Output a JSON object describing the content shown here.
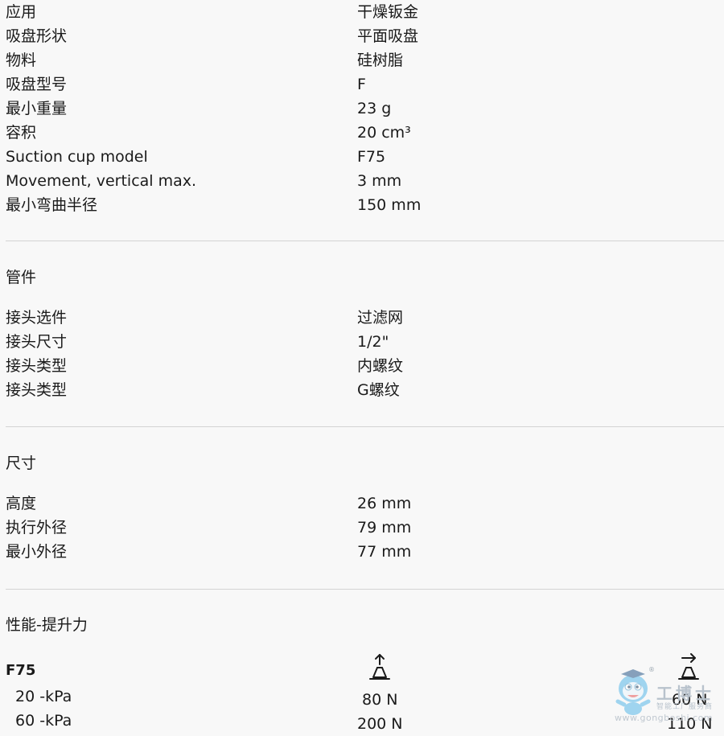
{
  "specs": [
    {
      "label": "应用",
      "value": "干燥钣金"
    },
    {
      "label": "吸盘形状",
      "value": "平面吸盘"
    },
    {
      "label": "物料",
      "value": "硅树脂"
    },
    {
      "label": "吸盘型号",
      "value": "F"
    },
    {
      "label": "最小重量",
      "value": "23 g"
    },
    {
      "label": "容积",
      "value": "20 cm³"
    },
    {
      "label": "Suction cup model",
      "value": "F75"
    },
    {
      "label": "Movement, vertical max.",
      "value": "3 mm"
    },
    {
      "label": "最小弯曲半径",
      "value": "150 mm"
    }
  ],
  "fittings": {
    "title": "管件",
    "rows": [
      {
        "label": "接头选件",
        "value": "过滤网"
      },
      {
        "label": "接头尺寸",
        "value": "1/2\""
      },
      {
        "label": "接头类型",
        "value": "内螺纹"
      },
      {
        "label": "接头类型",
        "value": "G螺纹"
      }
    ]
  },
  "dimensions": {
    "title": "尺寸",
    "rows": [
      {
        "label": "高度",
        "value": "26 mm"
      },
      {
        "label": "执行外径",
        "value": "79 mm"
      },
      {
        "label": "最小外径",
        "value": "77 mm"
      }
    ]
  },
  "performance": {
    "title": "性能-提升力",
    "model": "F75",
    "icons": [
      "vertical-lift-icon",
      "horizontal-lift-icon"
    ],
    "rows": [
      {
        "label": "20 -kPa",
        "vertical": "80 N",
        "horizontal": "60 N"
      },
      {
        "label": "60 -kPa",
        "vertical": "200 N",
        "horizontal": "110 N"
      }
    ]
  },
  "watermark": {
    "brand_text": "工博士",
    "tagline": "智能工厂服务商",
    "url": "www.gongboshi.com",
    "registered_mark": "®"
  }
}
